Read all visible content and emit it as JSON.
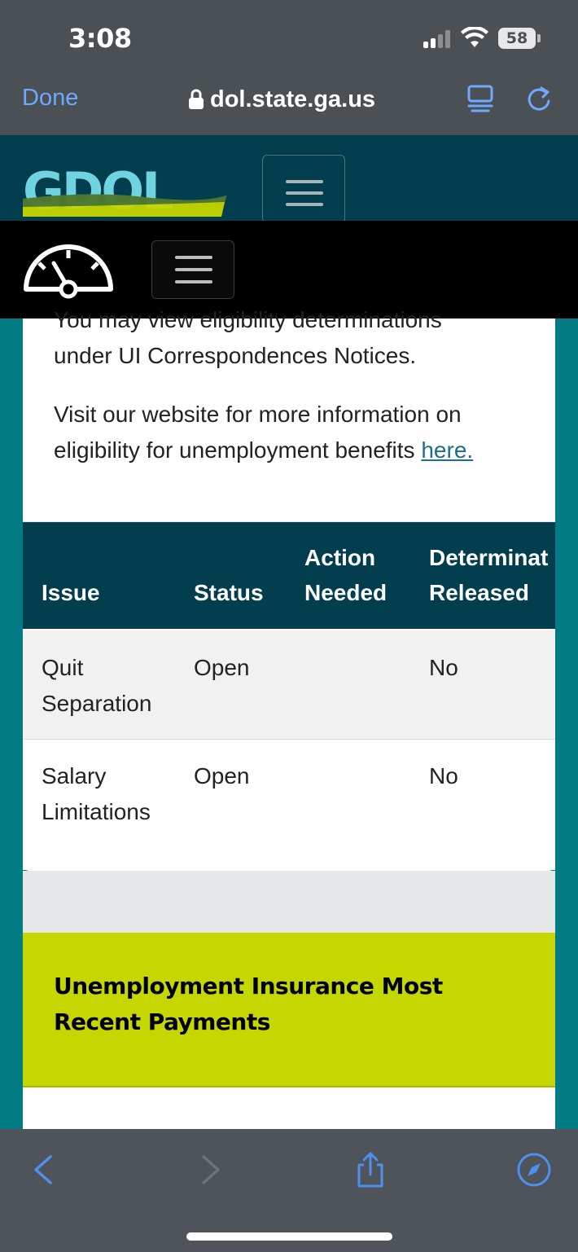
{
  "status_bar": {
    "time": "3:08",
    "battery": "58"
  },
  "browser": {
    "done_label": "Done",
    "url": "dol.state.ga.us",
    "icons": [
      "lock-icon",
      "reader-icon",
      "reload-icon"
    ]
  },
  "site_header": {
    "logo_text": "GDOL"
  },
  "eligibility": {
    "partial_line": "You may view eligibility determinations",
    "line2": "under UI Correspondences Notices.",
    "visit_text": "Visit our website for more information on eligibility for unemployment benefits ",
    "here_link": "here."
  },
  "issues_table": {
    "headers": {
      "issue": "Issue",
      "status": "Status",
      "action_line1": "Action",
      "action_line2": "Needed",
      "determination_line1": "Determinat",
      "determination_line2": "Released"
    },
    "rows": [
      {
        "issue_line1": "Quit",
        "issue_line2": "Separation",
        "status": "Open",
        "action": "",
        "released": "No"
      },
      {
        "issue_line1": "Salary",
        "issue_line2": "Limitations",
        "status": "Open",
        "action": "",
        "released": "No"
      }
    ]
  },
  "payments_card": {
    "title": "Unemployment Insurance Most Recent Payments"
  },
  "colors": {
    "header_dark": "#033e4e",
    "teal_bg": "#027b85",
    "accent_lime": "#c5d600",
    "link": "#1e6e8c",
    "safari_blue": "#6ea8ff"
  }
}
